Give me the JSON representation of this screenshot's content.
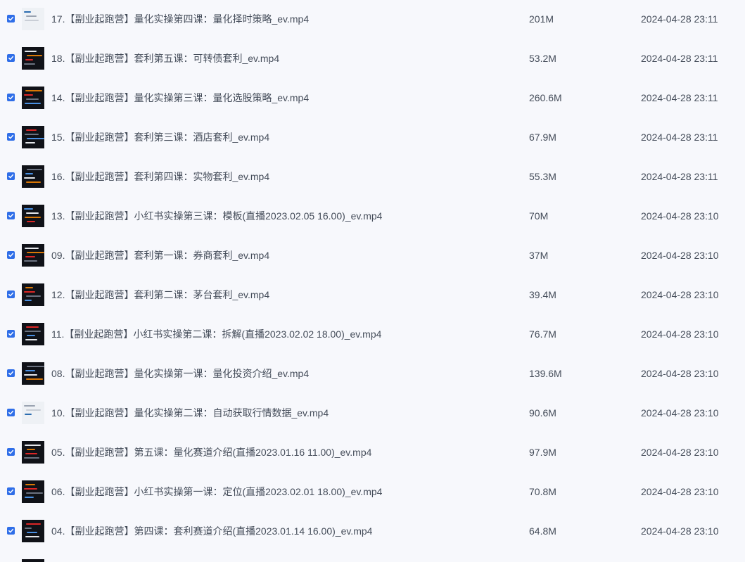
{
  "files": [
    {
      "name": "17.【副业起跑营】量化实操第四课：量化择时策略_ev.mp4",
      "size": "201M",
      "date": "2024-04-28 23:11",
      "thumbnail": "light"
    },
    {
      "name": "18.【副业起跑营】套利第五课：可转债套利_ev.mp4",
      "size": "53.2M",
      "date": "2024-04-28 23:11",
      "thumbnail": "dark"
    },
    {
      "name": "14.【副业起跑营】量化实操第三课：量化选股策略_ev.mp4",
      "size": "260.6M",
      "date": "2024-04-28 23:11",
      "thumbnail": "dark"
    },
    {
      "name": "15.【副业起跑营】套利第三课：酒店套利_ev.mp4",
      "size": "67.9M",
      "date": "2024-04-28 23:11",
      "thumbnail": "dark"
    },
    {
      "name": "16.【副业起跑营】套利第四课：实物套利_ev.mp4",
      "size": "55.3M",
      "date": "2024-04-28 23:11",
      "thumbnail": "dark"
    },
    {
      "name": "13.【副业起跑营】小红书实操第三课：模板(直播2023.02.05 16.00)_ev.mp4",
      "size": "70M",
      "date": "2024-04-28 23:10",
      "thumbnail": "dark"
    },
    {
      "name": "09.【副业起跑营】套利第一课：券商套利_ev.mp4",
      "size": "37M",
      "date": "2024-04-28 23:10",
      "thumbnail": "dark"
    },
    {
      "name": "12.【副业起跑营】套利第二课：茅台套利_ev.mp4",
      "size": "39.4M",
      "date": "2024-04-28 23:10",
      "thumbnail": "dark"
    },
    {
      "name": "11.【副业起跑营】小红书实操第二课：拆解(直播2023.02.02 18.00)_ev.mp4",
      "size": "76.7M",
      "date": "2024-04-28 23:10",
      "thumbnail": "dark"
    },
    {
      "name": "08.【副业起跑营】量化实操第一课：量化投资介绍_ev.mp4",
      "size": "139.6M",
      "date": "2024-04-28 23:10",
      "thumbnail": "dark"
    },
    {
      "name": "10.【副业起跑营】量化实操第二课：自动获取行情数据_ev.mp4",
      "size": "90.6M",
      "date": "2024-04-28 23:10",
      "thumbnail": "light"
    },
    {
      "name": "05.【副业起跑营】第五课：量化赛道介绍(直播2023.01.16 11.00)_ev.mp4",
      "size": "97.9M",
      "date": "2024-04-28 23:10",
      "thumbnail": "dark"
    },
    {
      "name": "06.【副业起跑营】小红书实操第一课：定位(直播2023.02.01 18.00)_ev.mp4",
      "size": "70.8M",
      "date": "2024-04-28 23:10",
      "thumbnail": "dark"
    },
    {
      "name": "04.【副业起跑营】第四课：套利赛道介绍(直播2023.01.14 16.00)_ev.mp4",
      "size": "64.8M",
      "date": "2024-04-28 23:10",
      "thumbnail": "dark"
    }
  ],
  "colors": {
    "checkbox": "#2f6ee8",
    "text": "#454d5a",
    "background": "#f7f8fc"
  },
  "icons": {
    "checkbox": "checkmark-icon",
    "thumbnail": "video-thumbnail"
  }
}
